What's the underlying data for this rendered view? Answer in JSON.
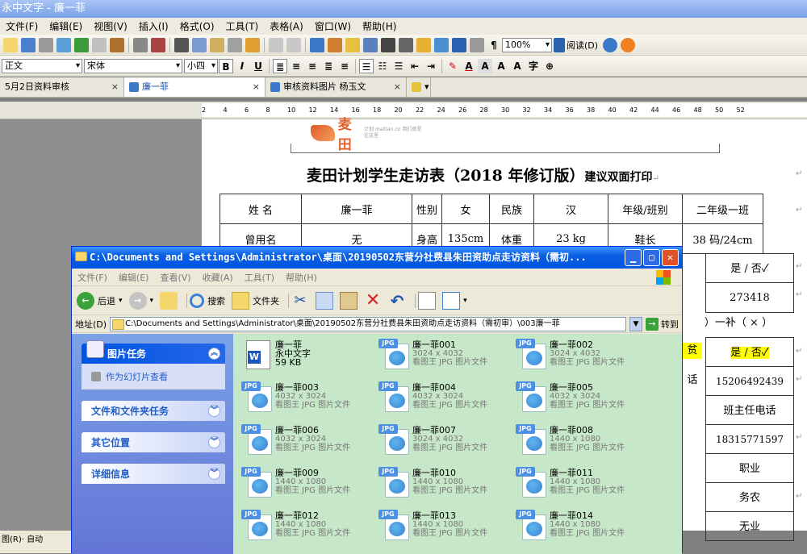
{
  "app": {
    "title": "永中文字 - 廉一菲"
  },
  "menu": [
    "文件(F)",
    "编辑(E)",
    "视图(V)",
    "插入(I)",
    "格式(O)",
    "工具(T)",
    "表格(A)",
    "窗口(W)",
    "帮助(H)"
  ],
  "toolbar1": {
    "zoom": "100%",
    "read_label": "阅读(D)"
  },
  "toolbar2": {
    "style": "正文",
    "font": "宋体",
    "size": "小四",
    "bold": "B",
    "italic": "I",
    "underline": "U"
  },
  "tabs": [
    {
      "label": "5月2日资料审核"
    },
    {
      "label": "廉一菲"
    },
    {
      "label": "审核资料图片  杨玉文"
    }
  ],
  "ruler_ticks": [
    "2",
    "4",
    "6",
    "8",
    "10",
    "12",
    "14",
    "16",
    "18",
    "20",
    "22",
    "24",
    "26",
    "28",
    "30",
    "32",
    "34",
    "36",
    "38",
    "40",
    "42",
    "44",
    "46",
    "48",
    "50",
    "52"
  ],
  "document": {
    "logo": "麦田",
    "logo_sub": "计划 maitian.cn 我们就是在这里",
    "title": "麦田计划学生走访表（2018 年修订版）",
    "title_note": "建议双面打印",
    "row1": [
      "姓  名",
      "廉一菲",
      "性别",
      "女",
      "民族",
      "汉",
      "年级/班别",
      "二年级一班"
    ],
    "row2": [
      "曾用名",
      "无",
      "身高",
      "135cm",
      "体重",
      "23 kg",
      "鞋长",
      "38 码/24cm"
    ],
    "right": [
      "是 / 否✓",
      "273418",
      "）一补（ × ）",
      "是 / 否✓",
      "15206492439",
      "班主任电话",
      "18315771597",
      "职业",
      "务农",
      "无业"
    ],
    "fragments": [
      "贫",
      "话"
    ]
  },
  "explorer": {
    "title": "C:\\Documents and Settings\\Administrator\\桌面\\20190502东营分社费县朱田资助点走访资料（需初...",
    "menu": [
      "文件(F)",
      "编辑(E)",
      "查看(V)",
      "收藏(A)",
      "工具(T)",
      "帮助(H)"
    ],
    "back": "后退",
    "search": "搜索",
    "folders": "文件夹",
    "address_label": "地址(D)",
    "address": "C:\\Documents and Settings\\Administrator\\桌面\\20190502东营分社费县朱田资助点走访资料（需初审）\\003廉一菲",
    "go": "转到",
    "tasks": {
      "picture_tasks": "图片任务",
      "slideshow": "作为幻灯片查看",
      "file_tasks": "文件和文件夹任务",
      "other_places": "其它位置",
      "details": "详细信息"
    },
    "files": [
      {
        "name": "廉一菲",
        "line2": "永中文字",
        "line3": "59 KB",
        "type": "doc"
      },
      {
        "name": "廉一菲001",
        "line2": "3024 x 4032",
        "line3": "看图王 JPG 图片文件",
        "type": "jpg"
      },
      {
        "name": "廉一菲002",
        "line2": "3024 x 4032",
        "line3": "看图王 JPG 图片文件",
        "type": "jpg"
      },
      {
        "name": "廉一菲003",
        "line2": "4032 x 3024",
        "line3": "看图王 JPG 图片文件",
        "type": "jpg"
      },
      {
        "name": "廉一菲004",
        "line2": "4032 x 3024",
        "line3": "看图王 JPG 图片文件",
        "type": "jpg"
      },
      {
        "name": "廉一菲005",
        "line2": "4032 x 3024",
        "line3": "看图王 JPG 图片文件",
        "type": "jpg"
      },
      {
        "name": "廉一菲006",
        "line2": "4032 x 3024",
        "line3": "看图王 JPG 图片文件",
        "type": "jpg"
      },
      {
        "name": "廉一菲007",
        "line2": "3024 x 4032",
        "line3": "看图王 JPG 图片文件",
        "type": "jpg"
      },
      {
        "name": "廉一菲008",
        "line2": "1440 x 1080",
        "line3": "看图王 JPG 图片文件",
        "type": "jpg"
      },
      {
        "name": "廉一菲009",
        "line2": "1440 x 1080",
        "line3": "看图王 JPG 图片文件",
        "type": "jpg"
      },
      {
        "name": "廉一菲010",
        "line2": "1440 x 1080",
        "line3": "看图王 JPG 图片文件",
        "type": "jpg"
      },
      {
        "name": "廉一菲011",
        "line2": "1440 x 1080",
        "line3": "看图王 JPG 图片文件",
        "type": "jpg"
      },
      {
        "name": "廉一菲012",
        "line2": "1440 x 1080",
        "line3": "看图王 JPG 图片文件",
        "type": "jpg"
      },
      {
        "name": "廉一菲013",
        "line2": "1440 x 1080",
        "line3": "看图王 JPG 图片文件",
        "type": "jpg"
      },
      {
        "name": "廉一菲014",
        "line2": "1440 x 1080",
        "line3": "看图王 JPG 图片文件",
        "type": "jpg"
      }
    ]
  },
  "status": {
    "left": "图(R)·  自动"
  }
}
